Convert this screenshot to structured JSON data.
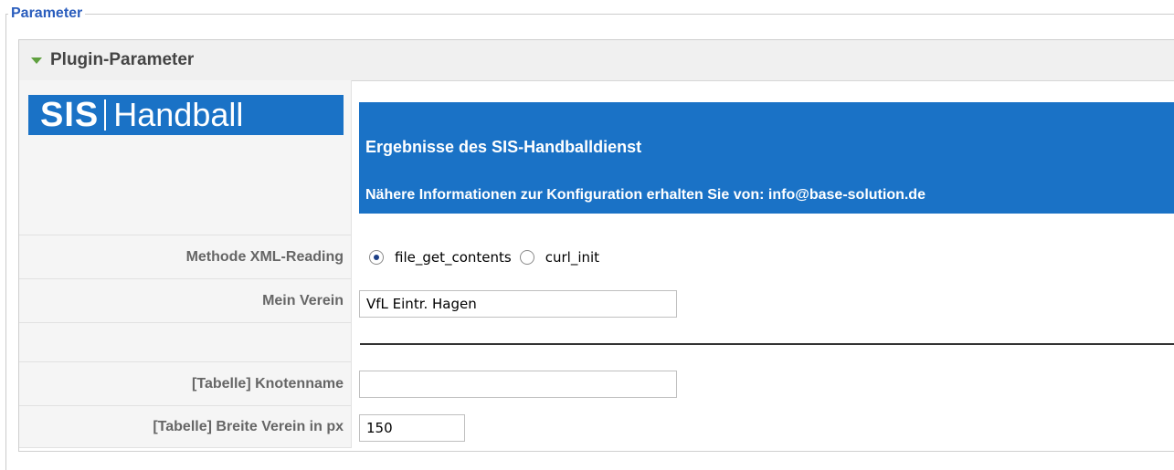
{
  "fieldset": {
    "legend": "Parameter"
  },
  "panel": {
    "title": "Plugin-Parameter",
    "logo": {
      "sis": "SIS",
      "handball": "Handball"
    },
    "banner": {
      "title": "Ergebnisse des SIS-Handballdienst",
      "info": "Nähere Informationen zur Konfiguration erhalten Sie von: info@base-solution.de"
    },
    "fields": {
      "method": {
        "label": "Methode XML-Reading",
        "options": [
          "file_get_contents",
          "curl_init"
        ],
        "selected": "file_get_contents"
      },
      "verein": {
        "label": "Mein Verein",
        "value": "VfL Eintr. Hagen"
      },
      "knotenname": {
        "label": "[Tabelle] Knotenname",
        "value": ""
      },
      "breite": {
        "label": "[Tabelle] Breite Verein in px",
        "value": "150"
      }
    }
  },
  "colors": {
    "accent": "#1a72c6",
    "legend": "#2a5dbd",
    "triangle": "#5fa03f"
  }
}
